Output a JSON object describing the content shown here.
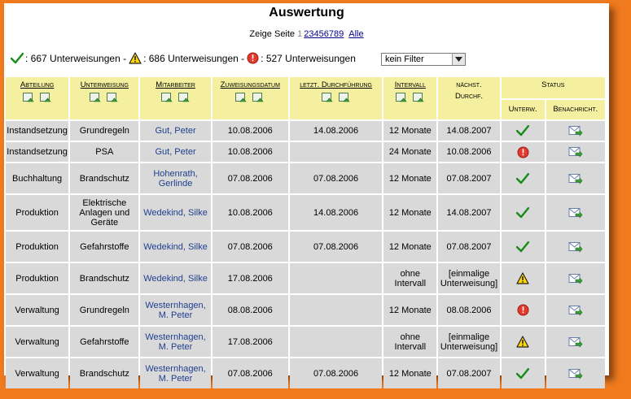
{
  "title": "Auswertung",
  "pager": {
    "label": "Zeige Seite",
    "current": "1",
    "pages": [
      "2",
      "3",
      "4",
      "5",
      "6",
      "7",
      "8",
      "9"
    ],
    "all": "Alle"
  },
  "summary": [
    {
      "icon": "check-icon",
      "text": ": 667 Unterweisungen -"
    },
    {
      "icon": "warning-icon",
      "text": ": 686 Unterweisungen -"
    },
    {
      "icon": "error-icon",
      "text": ": 527 Unterweisungen"
    }
  ],
  "filter": {
    "value": "kein Filter"
  },
  "headers": {
    "abteilung": "Abteilung",
    "unterweisung": "Unterweisung",
    "mitarbeiter": "Mitarbeiter",
    "zuweisungsdatum": "Zuweisungsdatum",
    "letzt": "letzt. Durchführung",
    "intervall": "Intervall",
    "naechst_1": "nächst.",
    "naechst_2": "Durchf.",
    "status": "Status",
    "unterw": "Unterw.",
    "benachricht": "Benachricht."
  },
  "colors": {
    "header_bg": "#f5f0a0",
    "cell_bg": "#d9d9d9",
    "link": "#1f3f8f",
    "frame": "#f07a1e"
  },
  "rows": [
    {
      "abteilung": "Instandsetzung",
      "unterweisung": "Grundregeln",
      "mitarbeiter": "Gut, Peter",
      "zuweisung": "10.08.2006",
      "letzt": "14.08.2006",
      "intervall": "12 Monate",
      "naechst": "14.08.2007",
      "status": "check-icon"
    },
    {
      "abteilung": "Instandsetzung",
      "unterweisung": "PSA",
      "mitarbeiter": "Gut, Peter",
      "zuweisung": "10.08.2006",
      "letzt": "",
      "intervall": "24 Monate",
      "naechst": "10.08.2006",
      "status": "error-icon"
    },
    {
      "abteilung": "Buchhaltung",
      "unterweisung": "Brandschutz",
      "mitarbeiter": "Hohenrath, Gerlinde",
      "zuweisung": "07.08.2006",
      "letzt": "07.08.2006",
      "intervall": "12 Monate",
      "naechst": "07.08.2007",
      "status": "check-icon"
    },
    {
      "abteilung": "Produktion",
      "unterweisung": "Elektrische Anlagen und Geräte",
      "mitarbeiter": "Wedekind, Silke",
      "zuweisung": "10.08.2006",
      "letzt": "14.08.2006",
      "intervall": "12 Monate",
      "naechst": "14.08.2007",
      "status": "check-icon"
    },
    {
      "abteilung": "Produktion",
      "unterweisung": "Gefahrstoffe",
      "mitarbeiter": "Wedekind, Silke",
      "zuweisung": "07.08.2006",
      "letzt": "07.08.2006",
      "intervall": "12 Monate",
      "naechst": "07.08.2007",
      "status": "check-icon"
    },
    {
      "abteilung": "Produktion",
      "unterweisung": "Brandschutz",
      "mitarbeiter": "Wedekind, Silke",
      "zuweisung": "17.08.2006",
      "letzt": "",
      "intervall": "ohne Intervall",
      "naechst": "[einmalige Unterweisung]",
      "status": "warning-icon"
    },
    {
      "abteilung": "Verwaltung",
      "unterweisung": "Grundregeln",
      "mitarbeiter": "Westernhagen, M. Peter",
      "zuweisung": "08.08.2006",
      "letzt": "",
      "intervall": "12 Monate",
      "naechst": "08.08.2006",
      "status": "error-icon"
    },
    {
      "abteilung": "Verwaltung",
      "unterweisung": "Gefahrstoffe",
      "mitarbeiter": "Westernhagen, M. Peter",
      "zuweisung": "17.08.2006",
      "letzt": "",
      "intervall": "ohne Intervall",
      "naechst": "[einmalige Unterweisung]",
      "status": "warning-icon"
    },
    {
      "abteilung": "Verwaltung",
      "unterweisung": "Brandschutz",
      "mitarbeiter": "Westernhagen, M. Peter",
      "zuweisung": "07.08.2006",
      "letzt": "07.08.2006",
      "intervall": "12 Monate",
      "naechst": "07.08.2007",
      "status": "check-icon"
    }
  ]
}
